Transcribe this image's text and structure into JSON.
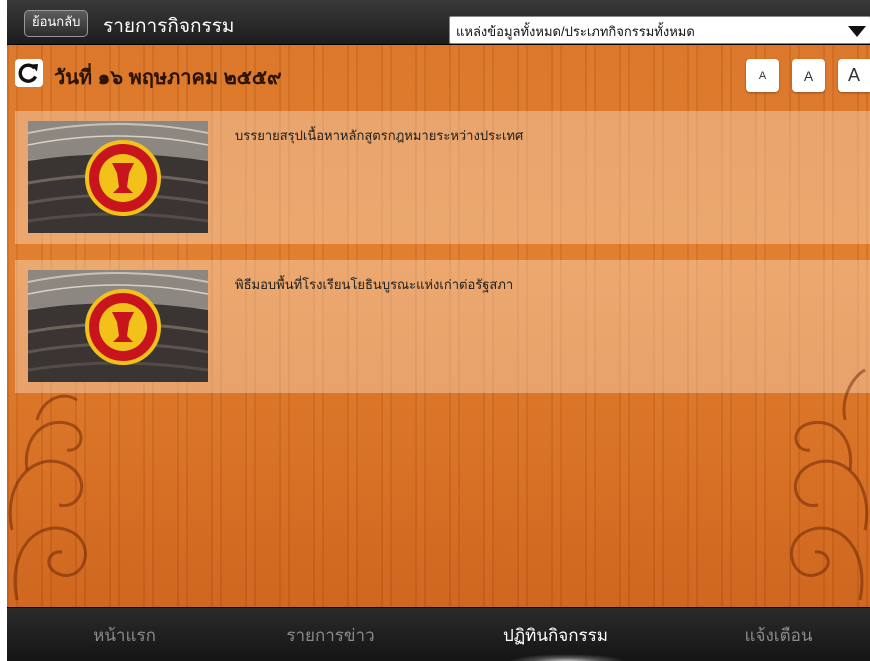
{
  "header": {
    "back_label": "ย้อนกลับ",
    "title": "รายการกิจกรรม",
    "source_filter": "แหล่งข้อมูลทั้งหมด/ประเภทกิจกรรมทั้งหมด"
  },
  "datebar": {
    "date": "วันที่ ๑๖ พฤษภาคม ๒๕๕๙",
    "font_size_buttons": [
      "A",
      "A",
      "A"
    ]
  },
  "activities": [
    {
      "title": "บรรยายสรุปเนื้อหาหลักสูตรกฎหมายระหว่างประเทศ"
    },
    {
      "title": "พิธีมอบพื้นที่โรงเรียนโยธินบูรณะแห่งเก่าต่อรัฐสภา"
    }
  ],
  "tabs": [
    {
      "label": "หน้าแรก",
      "active": false
    },
    {
      "label": "รายการข่าว",
      "active": false
    },
    {
      "label": "ปฏิทินกิจกรรม",
      "active": true
    },
    {
      "label": "แจ้งเตือน",
      "active": false
    }
  ],
  "icons": {
    "refresh": "refresh-icon",
    "dropdown": "chevron-down-icon",
    "emblem": "parliament-emblem-icon"
  },
  "colors": {
    "wood": "#d97327",
    "bar": "#1c1c1c",
    "emblem_red": "#c8141c",
    "emblem_gold": "#f2c21a"
  }
}
